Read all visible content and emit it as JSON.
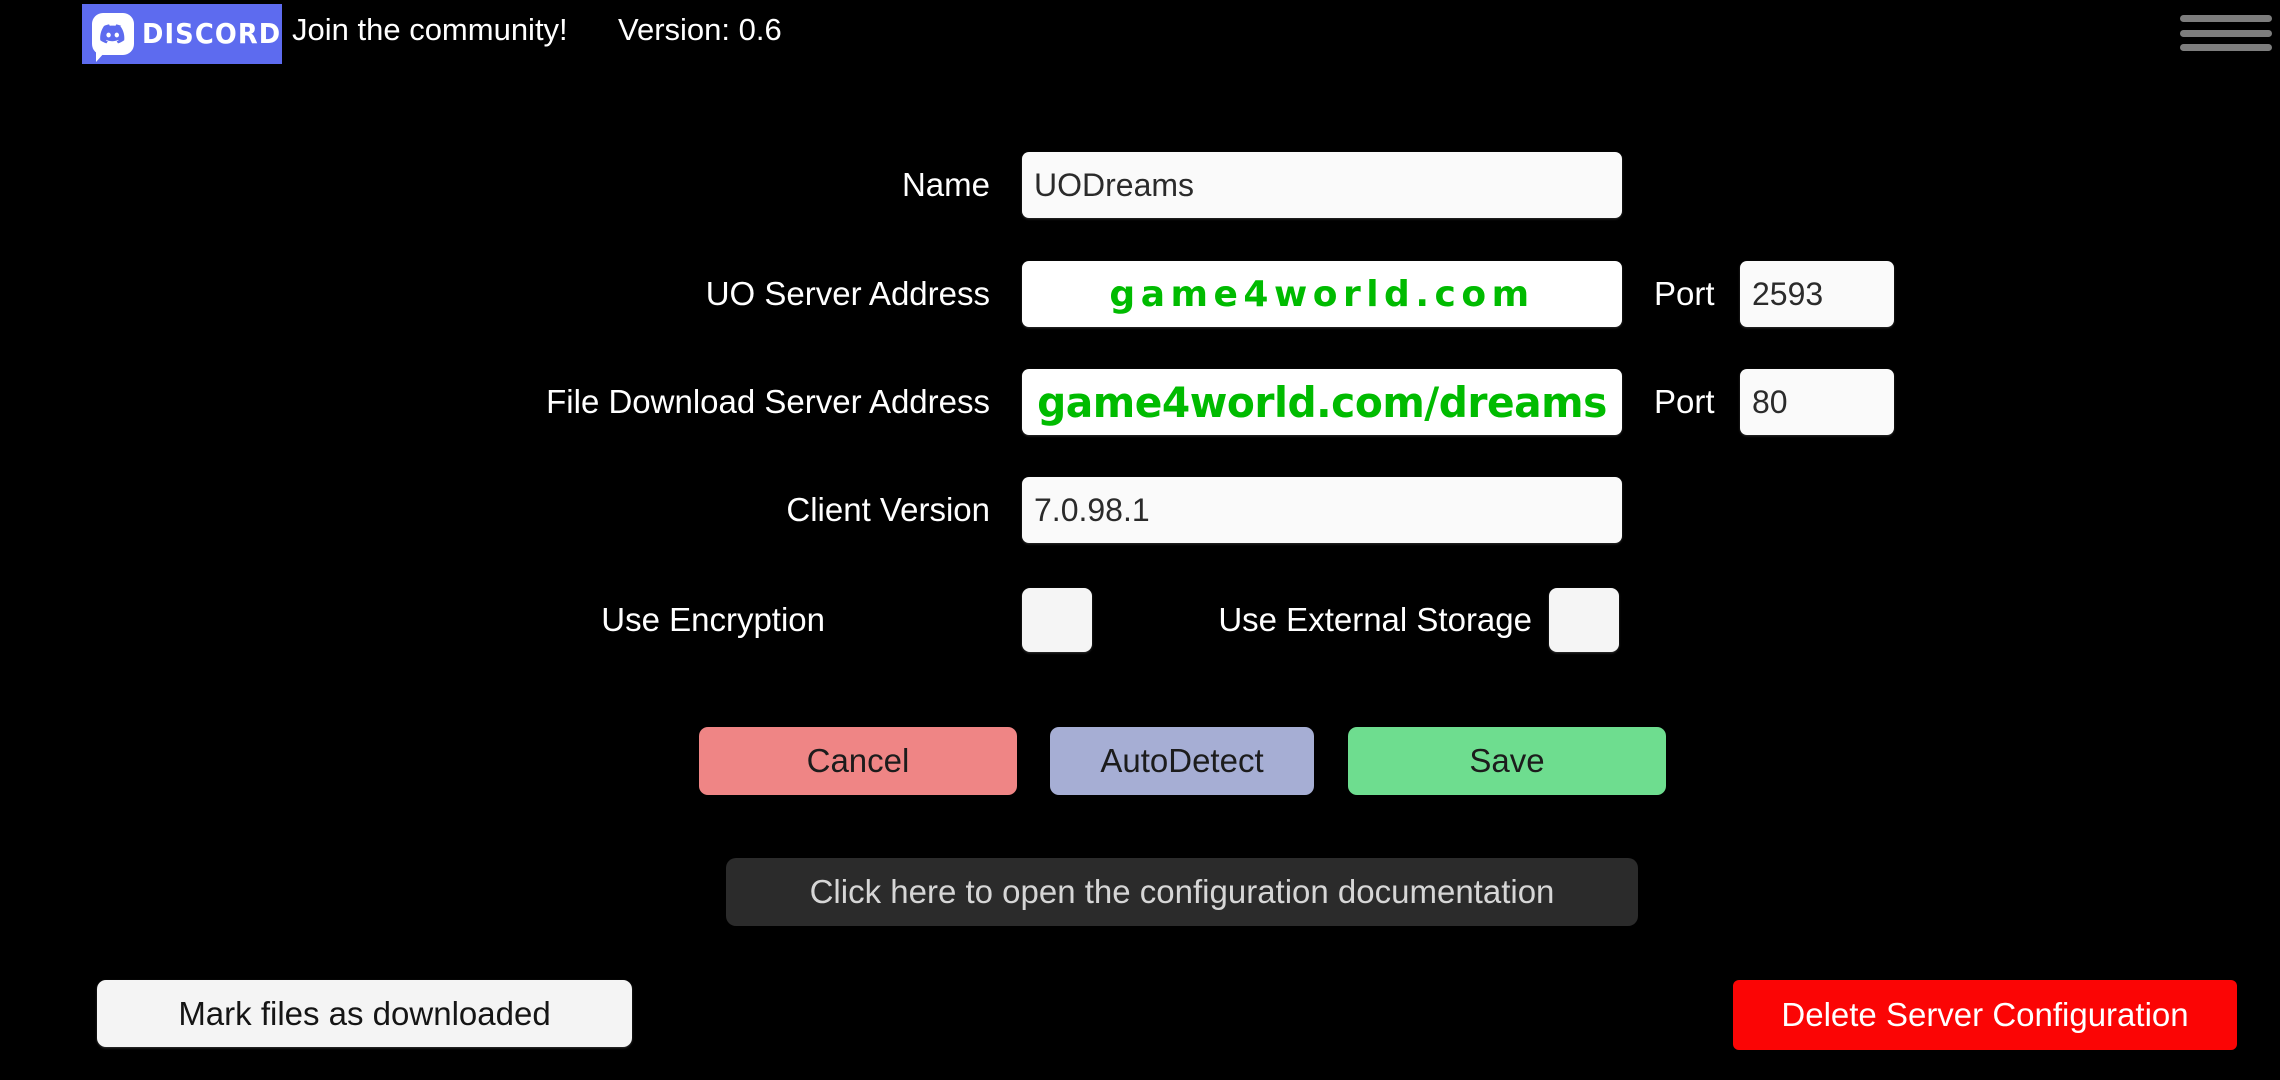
{
  "header": {
    "discord_badge_label": "DISCORD",
    "discord_icon": "discord-mascot-icon",
    "join_text": "Join the community!",
    "version_text": "Version: 0.6",
    "menu_icon": "hamburger-menu-icon",
    "badge_color": "#5d6bef"
  },
  "form": {
    "fields": [
      {
        "label": "Name",
        "value": "UODreams",
        "style": "plain"
      },
      {
        "label": "UO Server Address",
        "value": "game4world.com",
        "style": "green-spaced",
        "port_label": "Port",
        "port_value": "2593"
      },
      {
        "label": "File Download Server Address",
        "value": "game4world.com/dreams",
        "style": "green-condensed",
        "port_label": "Port",
        "port_value": "80"
      },
      {
        "label": "Client Version",
        "value": "7.0.98.1",
        "style": "plain"
      }
    ],
    "checkboxes": [
      {
        "label": "Use Encryption",
        "checked": false
      },
      {
        "label": "Use External Storage",
        "checked": false
      }
    ]
  },
  "buttons": {
    "cancel": "Cancel",
    "autodetect": "AutoDetect",
    "save": "Save",
    "docs": "Click here to open the configuration documentation",
    "mark_downloaded": "Mark files as downloaded",
    "delete_config": "Delete Server Configuration"
  },
  "colors": {
    "background": "#000000",
    "green_text": "#00bb00",
    "cancel": "#ef8585",
    "autodetect": "#a6aed4",
    "save": "#6edd8f",
    "delete": "#fb0505",
    "docs": "#2b2b2b"
  }
}
